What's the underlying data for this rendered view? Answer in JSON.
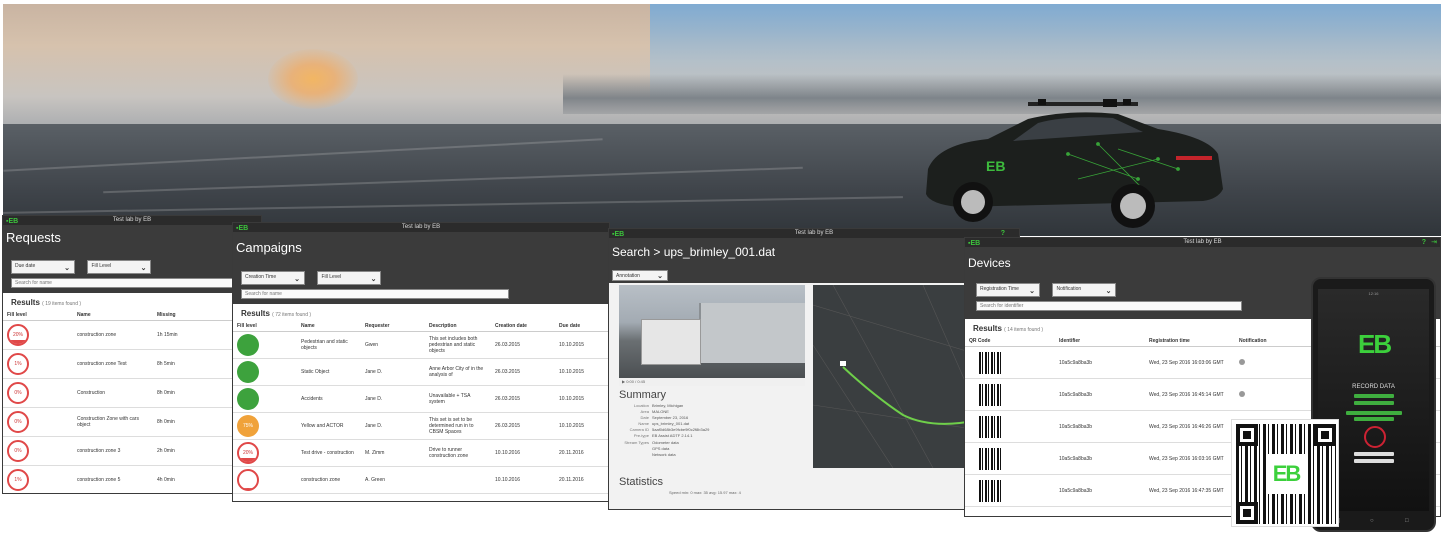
{
  "colors": {
    "accent": "#3cc43c",
    "chrome": "#3b3b3b",
    "fail": "#e04848",
    "pass": "#3da23d",
    "warn": "#f0a23a"
  },
  "hero": {
    "car_logo": "EB"
  },
  "requests": {
    "topbar_title": "Test lab by EB",
    "title": "Requests",
    "filter1": "Due date",
    "filter2": "Fill Level",
    "search_placeholder": "Search for name",
    "results_label": "Results",
    "results_count": "( 19 items found )",
    "columns": [
      "Fill level",
      "Name",
      "Missing"
    ],
    "rows": [
      {
        "fill": "20%",
        "fill_frac": 0.2,
        "name": "construction zone",
        "missing": "1h 15min"
      },
      {
        "fill": "1%",
        "fill_frac": 0.01,
        "name": "construction zone Test",
        "missing": "8h 5min"
      },
      {
        "fill": "0%",
        "fill_frac": 0.0,
        "name": "Construction",
        "missing": "8h 0min"
      },
      {
        "fill": "0%",
        "fill_frac": 0.0,
        "name": "Construction Zone with cars object",
        "missing": "8h 0min"
      },
      {
        "fill": "0%",
        "fill_frac": 0.0,
        "name": "construction zone 3",
        "missing": "2h 0min"
      },
      {
        "fill": "1%",
        "fill_frac": 0.01,
        "name": "construction zone 5",
        "missing": "4h 0min"
      }
    ]
  },
  "campaigns": {
    "topbar_title": "Test lab by EB",
    "title": "Campaigns",
    "filter1": "Creation Time",
    "filter2": "Fill Level",
    "search_placeholder": "Search for name",
    "results_label": "Results",
    "results_count": "( 72 items found )",
    "columns": [
      "Fill level",
      "Name",
      "Requester",
      "Description",
      "Creation date",
      "Due date"
    ],
    "rows": [
      {
        "kind": "green",
        "fill": "",
        "name": "Pedestrian and static objects",
        "requester": "Gwen",
        "desc": "This set includes both pedestrian and static objects",
        "created": "26.03.2015",
        "due": "10.10.2015"
      },
      {
        "kind": "green",
        "fill": "",
        "name": "Static Object",
        "requester": "Jane D.",
        "desc": "Anne Arbor City of in the analysis of",
        "created": "26.03.2015",
        "due": "10.10.2015"
      },
      {
        "kind": "green",
        "fill": "",
        "name": "Accidents",
        "requester": "Jane D.",
        "desc": "Unavailable + TSA system",
        "created": "26.03.2015",
        "due": "10.10.2015"
      },
      {
        "kind": "amber",
        "fill": "75%",
        "name": "Yellow and ACTOR",
        "requester": "Jane D.",
        "desc": "This set is set to be determined run in to CBSM Spaces",
        "created": "26.03.2015",
        "due": "10.10.2015"
      },
      {
        "kind": "red",
        "fill": "20%",
        "fill_frac": 0.2,
        "name": "Test drive - construction",
        "requester": "M. Zimm",
        "desc": "Drive to runner construction zone",
        "created": "10.10.2016",
        "due": "20.11.2016"
      },
      {
        "kind": "red",
        "fill": "",
        "fill_frac": 0.05,
        "name": "construction zone",
        "requester": "A. Green",
        "desc": "",
        "created": "10.10.2016",
        "due": "20.11.2016"
      }
    ]
  },
  "search": {
    "topbar_title": "Test lab by EB",
    "title": "Search > ups_brimley_001.dat",
    "filter1": "Annotation",
    "player_time": "0:00 / 0:45",
    "summary_title": "Summary",
    "summary": [
      {
        "k": "Location",
        "v": "Brimley, Michigan"
      },
      {
        "k": "Area",
        "v": "MALONE"
      },
      {
        "k": "Date",
        "v": "September 23, 2016"
      },
      {
        "k": "Name",
        "v": "ups_brimley_001.dat"
      },
      {
        "k": "Camera ID",
        "v": "5aaf0d68b3e9fcbe9f0c2f8b3a29"
      },
      {
        "k": "Pre-type",
        "v": "EB Assist ADTF 2.14.1"
      },
      {
        "k": "Stream Types",
        "v": "Odometer data"
      },
      {
        "k": "",
        "v": "GPS data"
      },
      {
        "k": "",
        "v": "Network data"
      }
    ],
    "stats_title": "Statistics",
    "stats_line": "Speed   min: 0      max: 35      avg: 15.97     max: 4"
  },
  "devices": {
    "topbar_title": "Test lab by EB",
    "title": "Devices",
    "filter1": "Registration Time",
    "filter2": "Notification",
    "search_placeholder": "Search for identifier",
    "results_label": "Results",
    "results_count": "( 14 items found )",
    "columns": [
      "QR Code",
      "Identifier",
      "Registration time",
      "Notification"
    ],
    "rows": [
      {
        "id": "10a5c9a8ba3b",
        "time": "Wed, 23 Sep 2016 16:03:06 GMT"
      },
      {
        "id": "10a5c9a8ba3b",
        "time": "Wed, 23 Sep 2016 16:45:14 GMT"
      },
      {
        "id": "10a5c9a8ba3b",
        "time": "Wed, 23 Sep 2016 16:46:26 GMT"
      },
      {
        "id": "10a5c9a8ba3b",
        "time": "Wed, 23 Sep 2016 16:03:16 GMT"
      },
      {
        "id": "10a5c9a8ba3b",
        "time": "Wed, 23 Sep 2016 16:47:35 GMT"
      }
    ]
  },
  "phone": {
    "status": "12:16",
    "logo": "EB",
    "record_label": "RECORD DATA"
  },
  "qr": {
    "logo": "EB"
  }
}
